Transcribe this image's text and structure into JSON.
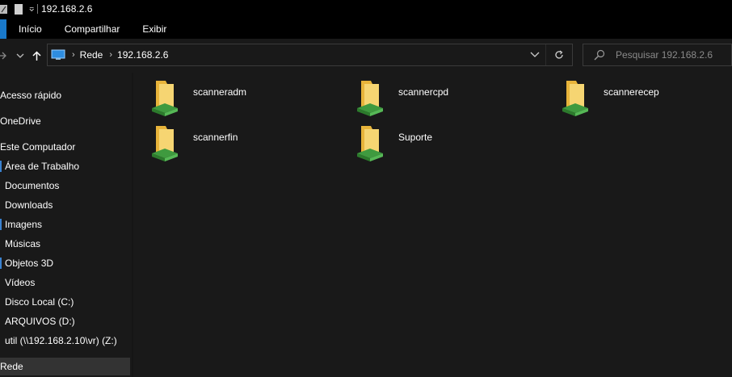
{
  "title_bar": {
    "path": "192.168.2.6"
  },
  "ribbon": {
    "tabs": [
      "Início",
      "Compartilhar",
      "Exibir"
    ]
  },
  "address": {
    "crumbs": [
      "Rede",
      "192.168.2.6"
    ]
  },
  "search": {
    "placeholder": "Pesquisar 192.168.2.6"
  },
  "sidebar": {
    "quick_access": "Acesso rápido",
    "onedrive": "OneDrive",
    "this_pc": "Este Computador",
    "children": [
      "Área de Trabalho",
      "Documentos",
      "Downloads",
      "Imagens",
      "Músicas",
      "Objetos 3D",
      "Vídeos",
      "Disco Local (C:)",
      "ARQUIVOS (D:)",
      "util (\\\\192.168.2.10\\vr) (Z:)"
    ],
    "network": "Rede"
  },
  "shares": [
    "scanneradm",
    "scannercpd",
    "scannerecep",
    "scannerfin",
    "Suporte"
  ],
  "colors": {
    "accent": "#1979ca",
    "folder": "#f0c54e",
    "share_pipe": "#4caf50"
  }
}
